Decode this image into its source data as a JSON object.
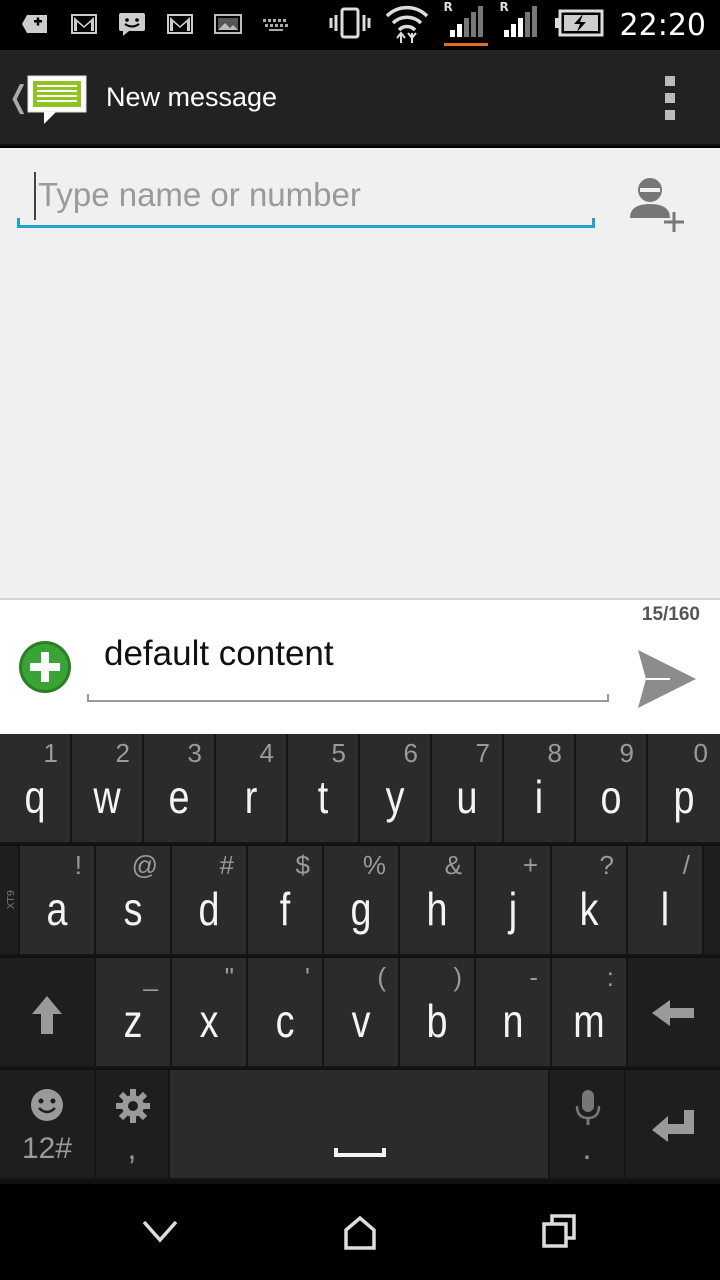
{
  "status_bar": {
    "time": "22:20",
    "left_icons": [
      "add-notification-icon",
      "gmail-icon",
      "sms-icon",
      "gmail-icon",
      "image-icon",
      "keyboard-icon"
    ],
    "right_icons": [
      "vibrate-icon",
      "wifi-icon",
      "signal-roaming-icon",
      "signal-roaming-icon",
      "battery-charging-icon"
    ],
    "roaming_label": "R"
  },
  "action_bar": {
    "title": "New message",
    "back_glyph": "❬"
  },
  "recipient": {
    "placeholder": "Type name or number",
    "value": ""
  },
  "compose": {
    "counter": "15/160",
    "message": "default content"
  },
  "keyboard": {
    "brand": "XT9",
    "row1": [
      {
        "key": "q",
        "hint": "1"
      },
      {
        "key": "w",
        "hint": "2"
      },
      {
        "key": "e",
        "hint": "3"
      },
      {
        "key": "r",
        "hint": "4"
      },
      {
        "key": "t",
        "hint": "5"
      },
      {
        "key": "y",
        "hint": "6"
      },
      {
        "key": "u",
        "hint": "7"
      },
      {
        "key": "i",
        "hint": "8"
      },
      {
        "key": "o",
        "hint": "9"
      },
      {
        "key": "p",
        "hint": "0"
      }
    ],
    "row2": [
      {
        "key": "a",
        "hint": "!"
      },
      {
        "key": "s",
        "hint": "@"
      },
      {
        "key": "d",
        "hint": "#"
      },
      {
        "key": "f",
        "hint": "$"
      },
      {
        "key": "g",
        "hint": "%"
      },
      {
        "key": "h",
        "hint": "&"
      },
      {
        "key": "j",
        "hint": "+"
      },
      {
        "key": "k",
        "hint": "?"
      },
      {
        "key": "l",
        "hint": "/"
      }
    ],
    "row3": [
      {
        "key": "z",
        "hint": "_"
      },
      {
        "key": "x",
        "hint": "\""
      },
      {
        "key": "c",
        "hint": "'"
      },
      {
        "key": "v",
        "hint": "("
      },
      {
        "key": "b",
        "hint": ")"
      },
      {
        "key": "n",
        "hint": "-"
      },
      {
        "key": "m",
        "hint": ":"
      }
    ],
    "symbols_label": "12#",
    "comma": ",",
    "period": "."
  },
  "colors": {
    "accent": "#1fa3d0",
    "attach_green": "#3aa335",
    "action_bar": "#222222",
    "keyboard_key": "#2b2b2b"
  }
}
